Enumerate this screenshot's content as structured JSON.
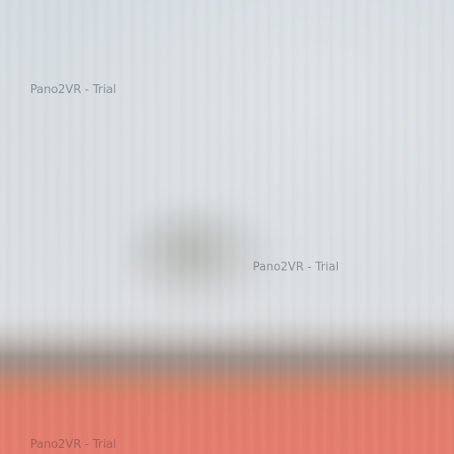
{
  "watermarks": {
    "top_left": "Pano2VR - Trial",
    "center": "Pano2VR - Trial",
    "bottom_left": "Pano2VR - Trial"
  }
}
